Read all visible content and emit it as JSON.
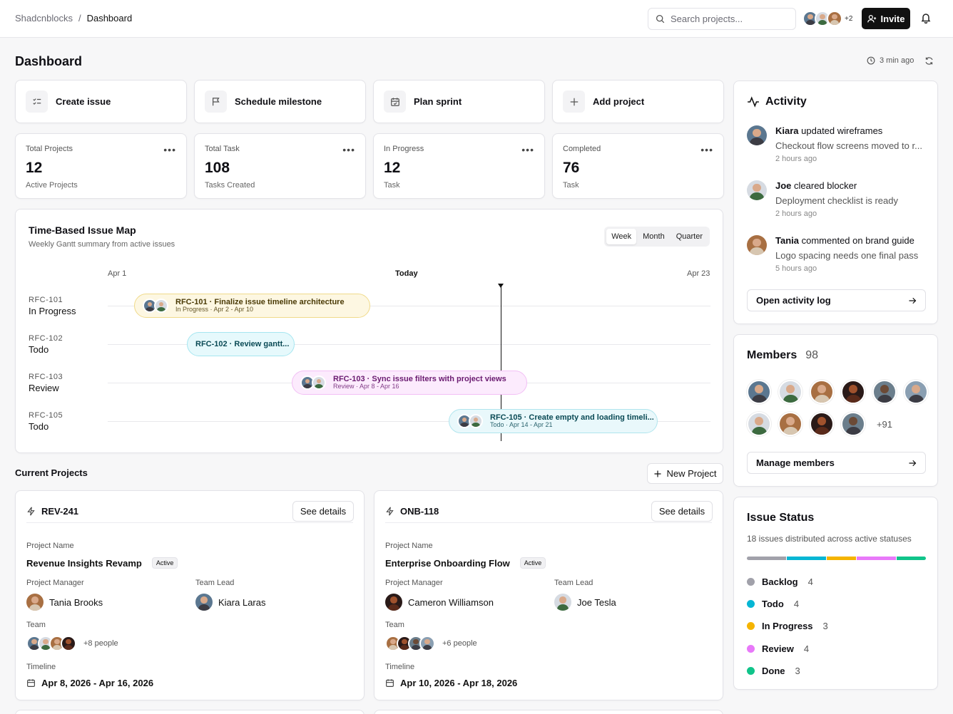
{
  "breadcrumb": {
    "root": "Shadcnblocks",
    "sep": "/",
    "current": "Dashboard"
  },
  "search": {
    "placeholder": "Search projects..."
  },
  "top_avatars_more": "+2",
  "invite_label": "Invite",
  "page_title": "Dashboard",
  "updated_label": "3 min ago",
  "quick_actions": [
    {
      "label": "Create issue",
      "icon": "checklist-icon"
    },
    {
      "label": "Schedule milestone",
      "icon": "flag-icon"
    },
    {
      "label": "Plan sprint",
      "icon": "calendar-icon"
    },
    {
      "label": "Add project",
      "icon": "plus-icon"
    }
  ],
  "stats": [
    {
      "label": "Total Projects",
      "value": "12",
      "sub": "Active Projects"
    },
    {
      "label": "Total Task",
      "value": "108",
      "sub": "Tasks Created"
    },
    {
      "label": "In Progress",
      "value": "12",
      "sub": "Task"
    },
    {
      "label": "Completed",
      "value": "76",
      "sub": "Task"
    }
  ],
  "gantt": {
    "title": "Time-Based Issue Map",
    "subtitle": "Weekly Gantt summary from active issues",
    "ranges": [
      "Week",
      "Month",
      "Quarter"
    ],
    "axis_start": "Apr 1",
    "axis_today": "Today",
    "axis_end": "Apr 23",
    "rows": [
      {
        "id": "RFC-101",
        "status": "In Progress",
        "title": "RFC-101 · Finalize issue timeline architecture",
        "meta": "In Progress · Apr 2 - Apr 10"
      },
      {
        "id": "RFC-102",
        "status": "Todo",
        "title": "RFC-102 · Review gantt...",
        "meta": ""
      },
      {
        "id": "RFC-103",
        "status": "Review",
        "title": "RFC-103 · Sync issue filters with project views",
        "meta": "Review · Apr 8 - Apr 16"
      },
      {
        "id": "RFC-105",
        "status": "Todo",
        "title": "RFC-105 · Create empty and loading timeli...",
        "meta": "Todo · Apr 14 - Apr 21"
      }
    ]
  },
  "current_projects": {
    "title": "Current Projects",
    "new_label": "New Project",
    "projects": [
      {
        "id": "REV-241",
        "details_label": "See details",
        "name_label": "Project Name",
        "name": "Revenue Insights Revamp",
        "badge": "Active",
        "pm_label": "Project Manager",
        "pm": "Tania Brooks",
        "lead_label": "Team Lead",
        "lead": "Kiara Laras",
        "team_label": "Team",
        "team_more": "+8 people",
        "timeline_label": "Timeline",
        "timeline": "Apr 8, 2026 - Apr 16, 2026"
      },
      {
        "id": "ONB-118",
        "details_label": "See details",
        "name_label": "Project Name",
        "name": "Enterprise Onboarding Flow",
        "badge": "Active",
        "pm_label": "Project Manager",
        "pm": "Cameron Williamson",
        "lead_label": "Team Lead",
        "lead": "Joe Tesla",
        "team_label": "Team",
        "team_more": "+6 people",
        "timeline_label": "Timeline",
        "timeline": "Apr 10, 2026 - Apr 18, 2026"
      }
    ]
  },
  "activity": {
    "title": "Activity",
    "items": [
      {
        "name": "Kiara",
        "action": " updated wireframes",
        "detail": "Checkout flow screens moved to r...",
        "time": "2 hours ago"
      },
      {
        "name": "Joe",
        "action": " cleared blocker",
        "detail": "Deployment checklist is ready",
        "time": "2 hours ago"
      },
      {
        "name": "Tania",
        "action": " commented on brand guide",
        "detail": "Logo spacing needs one final pass",
        "time": "5 hours ago"
      }
    ],
    "log_label": "Open activity log"
  },
  "members": {
    "title": "Members",
    "count": "98",
    "more": "+91",
    "manage_label": "Manage members"
  },
  "issue_status": {
    "title": "Issue Status",
    "subtitle": "18 issues distributed across active statuses",
    "items": [
      {
        "label": "Backlog",
        "count": "4",
        "color": "#a1a1aa"
      },
      {
        "label": "Todo",
        "count": "4",
        "color": "#06b6d4"
      },
      {
        "label": "In Progress",
        "count": "3",
        "color": "#f5b400"
      },
      {
        "label": "Review",
        "count": "4",
        "color": "#e879f9"
      },
      {
        "label": "Done",
        "count": "3",
        "color": "#10c48a"
      }
    ]
  }
}
